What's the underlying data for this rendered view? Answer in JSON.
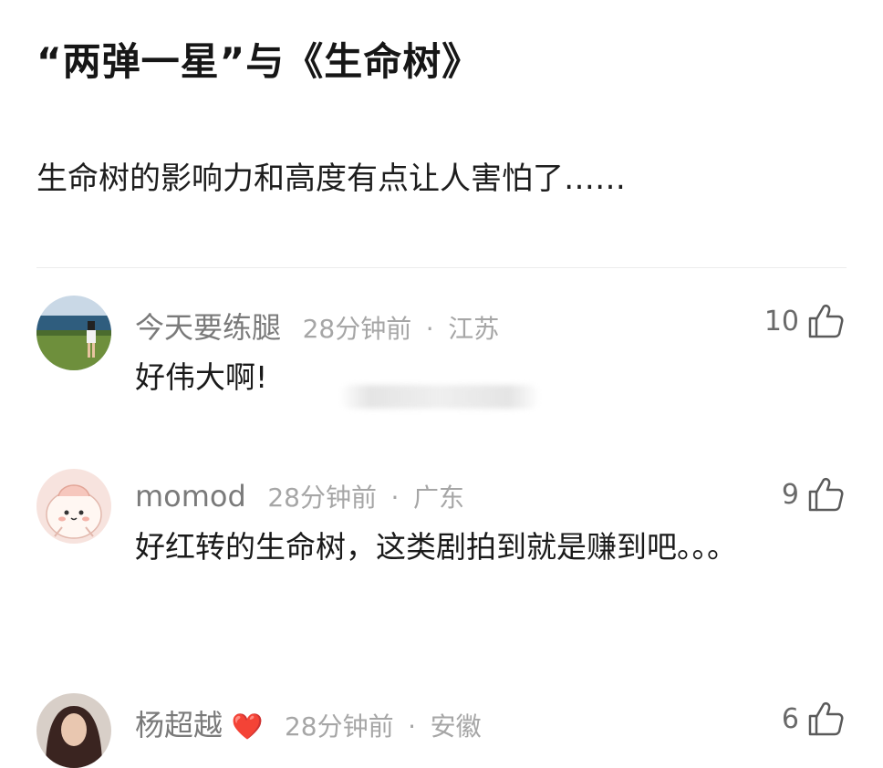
{
  "post": {
    "title": "“两弹一星”与《生命树》",
    "subtitle": "生命树的影响力和高度有点让人害怕了……"
  },
  "comments": [
    {
      "name": "今天要练腿",
      "time": "28分钟前",
      "dot": "·",
      "location": "江苏",
      "text": "好伟大啊!",
      "likes": "10"
    },
    {
      "name": "momod",
      "time": "28分钟前",
      "dot": "·",
      "location": "广东",
      "text": "好红转的生命树，这类剧拍到就是赚到吧。。。",
      "likes": "9"
    },
    {
      "name": "杨超越",
      "badge": "❤️",
      "time": "28分钟前",
      "dot": "·",
      "location": "安徽",
      "text": "",
      "likes": "6"
    }
  ],
  "icons": {
    "like": "thumbs-up-icon",
    "heart": "heart-icon"
  },
  "colors": {
    "text": "#1a1a1a",
    "meta": "#a6a6a6",
    "heart": "#e53935"
  }
}
